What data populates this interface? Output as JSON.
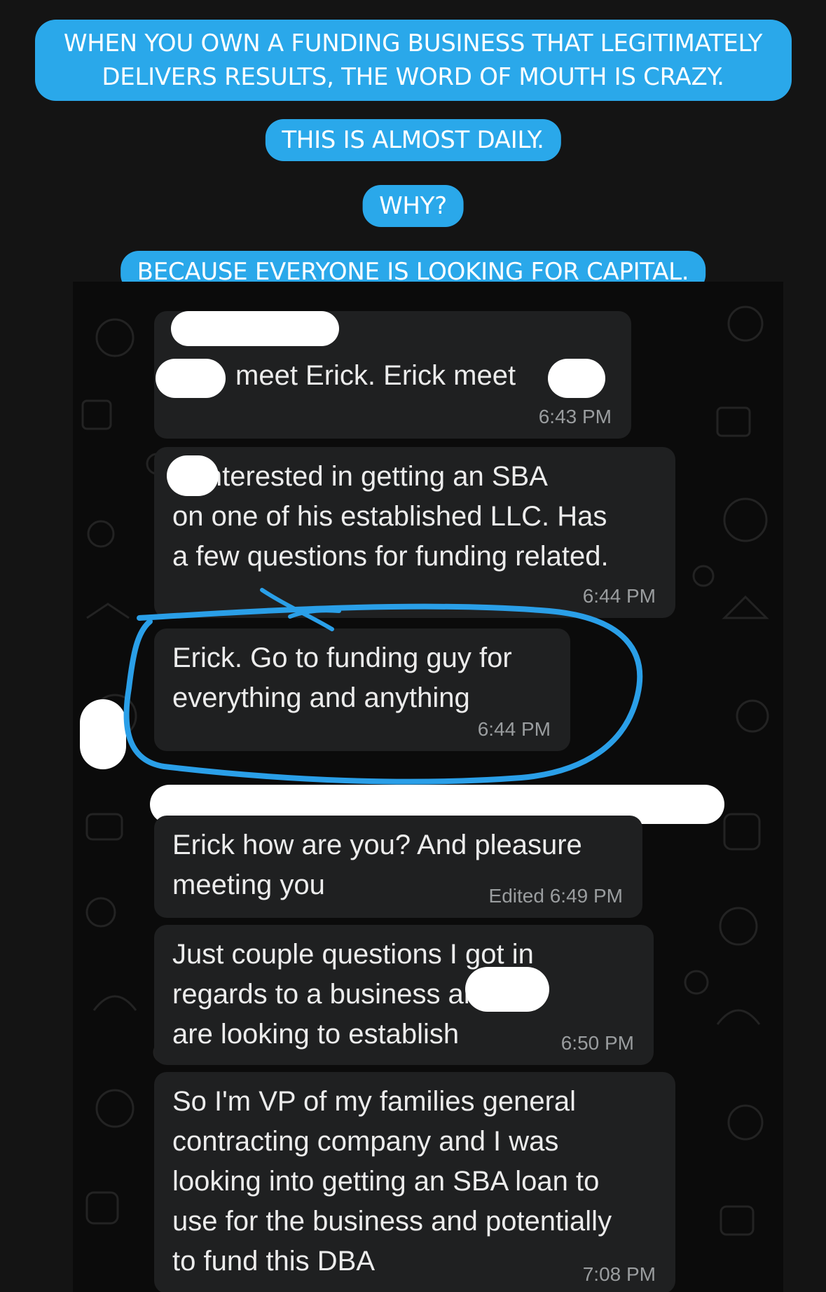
{
  "captions": [
    "WHEN YOU OWN A FUNDING BUSINESS THAT LEGITIMATELY\nDELIVERS RESULTS, THE WORD OF MOUTH IS CRAZY.",
    "THIS IS ALMOST DAILY.",
    "WHY?",
    "BECAUSE EVERYONE IS LOOKING FOR CAPITAL."
  ],
  "messages": [
    {
      "text": "meet Erick. Erick meet",
      "time": "6:43 PM"
    },
    {
      "text": "is interested in getting an SBA\non one of his established LLC. Has\na few questions for funding related.",
      "time": "6:44 PM"
    },
    {
      "text": "Erick. Go to funding guy for\neverything and anything",
      "time": "6:44 PM"
    },
    {
      "text": "Erick how are you? And pleasure\nmeeting you",
      "time": "Edited 6:49 PM"
    },
    {
      "text": "Just couple questions I got in\nregards to a business              and I\nare looking to establish",
      "time": "6:50 PM"
    },
    {
      "text": "So I'm VP of my families general\ncontracting company and I was\nlooking into getting an SBA loan to\nuse for the business and potentially\nto fund this DBA",
      "time": "7:08 PM"
    }
  ],
  "colors": {
    "caption_bg": "#2aa8ea",
    "bubble_bg": "#1f2021",
    "highlight_stroke": "#2a9fe8",
    "timestamp": "#9a9d9f"
  }
}
